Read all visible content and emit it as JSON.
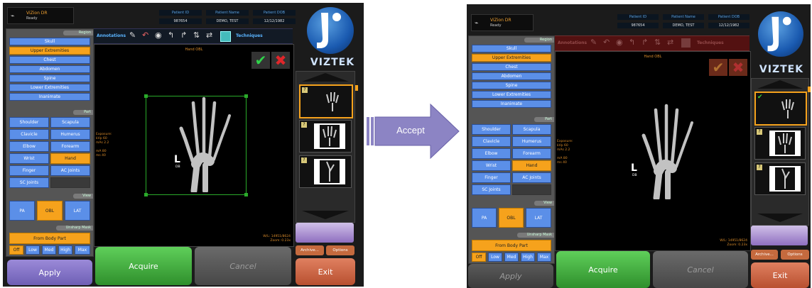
{
  "app": {
    "name": "ViZion DR",
    "status": "Ready",
    "brand": "VIZTEK"
  },
  "patient": {
    "headers": [
      "Patient ID",
      "Patient Name",
      "Patient DOB"
    ],
    "values": [
      "987654",
      "DEMO, TEST",
      "12/12/1982"
    ]
  },
  "sections": {
    "region": "Region",
    "part": "Part",
    "view": "View",
    "unsharp": "Unsharp Mask"
  },
  "regions": [
    "Skull",
    "Upper Extremities",
    "Chest",
    "Abdomen",
    "Spine",
    "Lower Extremities",
    "Inanimate"
  ],
  "parts": [
    "Shoulder",
    "Scapula",
    "Clavicle",
    "Humerus",
    "Elbow",
    "Forearm",
    "Wrist",
    "Hand",
    "Finger",
    "AC Joints",
    "SC Joints"
  ],
  "views": [
    "PA",
    "OBL",
    "LAT"
  ],
  "unsharp_mode": "From Body Part",
  "unsharp_levels": [
    "Off",
    "Low",
    "Med",
    "High",
    "Max"
  ],
  "toolbar": {
    "annotations": "Annotations",
    "techniques": "Techniques"
  },
  "image": {
    "title": "Hand OBL",
    "exposure_label": "Exposure:",
    "kvp": "kVp 60",
    "mas": "mAs 2.2",
    "ma": "mA 80",
    "ms": "ms 40",
    "wl_left": "W/L: 14951/8624",
    "zoom_left": "Zoom: 0.23x",
    "wl_right": "W/L: 14951/8624",
    "zoom_right": "Zoom: 0.23x",
    "marker": "L",
    "marker_sub": "DB"
  },
  "buttons": {
    "archive": "Archive...",
    "options": "Options",
    "apply": "Apply",
    "acquire": "Acquire",
    "cancel": "Cancel",
    "exit": "Exit"
  },
  "arrow_label": "Accept",
  "colors": {
    "selected": "#f6a21c",
    "button_blue": "#5b8fe8",
    "accept_arrow": "#8c84c4"
  }
}
